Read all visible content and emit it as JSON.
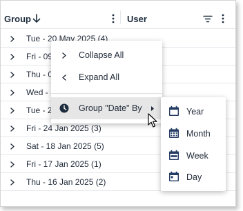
{
  "header": {
    "group_label": "Group",
    "user_label": "User"
  },
  "rows": [
    {
      "label": "Tue - 20 May 2025 (4)"
    },
    {
      "label": "Fri - 09"
    },
    {
      "label": "Thu - 0"
    },
    {
      "label": "Wed -"
    },
    {
      "label": "Tue - 2"
    },
    {
      "label": "Fri - 24 Jan 2025 (3)"
    },
    {
      "label": "Sat - 18 Jan 2025 (5)"
    },
    {
      "label": "Fri - 17 Jan 2025 (1)"
    },
    {
      "label": "Thu - 16 Jan 2025 (2)"
    }
  ],
  "context_menu": {
    "collapse_all": "Collapse All",
    "expand_all": "Expand All",
    "group_by": "Group \"Date\" By"
  },
  "submenu": {
    "items": [
      {
        "label": "Year"
      },
      {
        "label": "Month"
      },
      {
        "label": "Week"
      },
      {
        "label": "Day"
      }
    ]
  },
  "colors": {
    "header_text": "#1e2d3d",
    "icon_dark": "#1e2d3d",
    "calendar_icon": "#243b63",
    "hover_bg": "#e6e6e6"
  },
  "icons": {
    "sort": "arrow-down-icon",
    "column_menu": "kebab-icon",
    "filter": "filter-icon",
    "row_expand": "chevron-right-icon",
    "collapse": "chevron-right-icon",
    "expand": "chevron-left-icon",
    "group_by": "clock-icon",
    "submenu_arrow": "triangle-right-icon",
    "year": "calendar-icon",
    "month": "calendar-icon",
    "week": "calendar-icon",
    "day": "calendar-icon"
  }
}
